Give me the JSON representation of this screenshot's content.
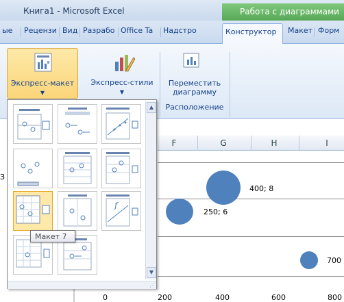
{
  "window": {
    "app_title": "Книга1  -  Microsoft Excel",
    "context_tab_header": "Работа с диаграммами"
  },
  "tabs": [
    {
      "label": "ые"
    },
    {
      "label": "Рецензи"
    },
    {
      "label": "Вид"
    },
    {
      "label": "Разрабо"
    },
    {
      "label": "Office Ta"
    },
    {
      "label": "Надстро"
    },
    {
      "label": "Конструктор",
      "active": true
    },
    {
      "label": "Макет"
    },
    {
      "label": "Форм"
    }
  ],
  "ribbon": {
    "express_layout": "Экспресс-макет",
    "express_styles": "Экспресс-стили",
    "move_chart_line1": "Переместить",
    "move_chart_line2": "диаграмму",
    "group_location": "Расположение"
  },
  "gallery": {
    "tooltip": "Макет 7",
    "selected_index": 6,
    "layouts": [
      "layout-1",
      "layout-2",
      "layout-3",
      "layout-4",
      "layout-5",
      "layout-6",
      "layout-7",
      "layout-8",
      "layout-9",
      "layout-10",
      "layout-11"
    ]
  },
  "sheet": {
    "columns": [
      "F",
      "G",
      "H",
      "I"
    ],
    "row_fragment": "З"
  },
  "chart_data": {
    "type": "scatter",
    "series": [
      {
        "points": [
          {
            "x": 250,
            "y": 6,
            "label": "250; 6"
          },
          {
            "x": 400,
            "y": 8,
            "label": "400; 8"
          },
          {
            "x": 700,
            "label": "700"
          }
        ]
      }
    ],
    "x_ticks": [
      "0",
      "200",
      "400",
      "600",
      "800"
    ],
    "grid": true
  },
  "colors": {
    "bubble": "#4f81bd",
    "context_green": "#56a856",
    "selection": "#fbd57a"
  }
}
